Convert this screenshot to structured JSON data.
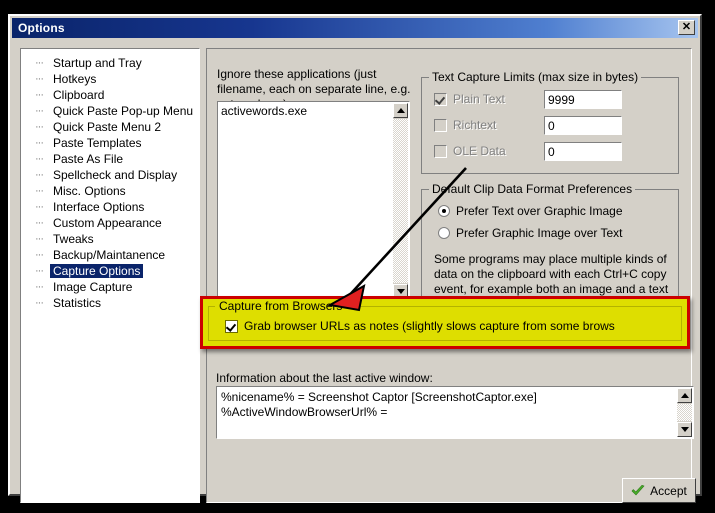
{
  "window": {
    "title": "Options",
    "close_label": "✕"
  },
  "sidebar": {
    "items": [
      {
        "label": "Startup and Tray",
        "selected": false
      },
      {
        "label": "Hotkeys",
        "selected": false
      },
      {
        "label": "Clipboard",
        "selected": false
      },
      {
        "label": "Quick Paste Pop-up Menu",
        "selected": false
      },
      {
        "label": "Quick Paste Menu 2",
        "selected": false
      },
      {
        "label": "Paste Templates",
        "selected": false
      },
      {
        "label": "Paste As File",
        "selected": false
      },
      {
        "label": "Spellcheck and Display",
        "selected": false
      },
      {
        "label": "Misc. Options",
        "selected": false
      },
      {
        "label": "Interface Options",
        "selected": false
      },
      {
        "label": "Custom Appearance",
        "selected": false
      },
      {
        "label": "Tweaks",
        "selected": false
      },
      {
        "label": "Backup/Maintanence",
        "selected": false
      },
      {
        "label": "Capture Options",
        "selected": true
      },
      {
        "label": "Image Capture",
        "selected": false
      },
      {
        "label": "Statistics",
        "selected": false
      }
    ]
  },
  "ignore_apps": {
    "label": "Ignore these applications (just filename, each on separate line, e.g. notepad.exe)",
    "value": "activewords.exe"
  },
  "text_capture_limits": {
    "title": "Text Capture Limits (max size in bytes)",
    "rows": [
      {
        "label": "Plain Text",
        "checked": true,
        "value": "9999"
      },
      {
        "label": "Richtext",
        "checked": false,
        "value": "0"
      },
      {
        "label": "OLE Data",
        "checked": false,
        "value": "0"
      }
    ]
  },
  "clip_format": {
    "title": "Default Clip Data Format Preferences",
    "option_text_first": "Prefer Text over Graphic Image",
    "option_image_first": "Prefer Graphic Image over Text",
    "selected": "text_first",
    "description": "Some programs may place multiple kinds of data on the clipboard with each Ctrl+C copy event, for example both an image and a text representation of some data.  Here you can specify which format should be captured by default."
  },
  "capture_browsers": {
    "title": "Capture from Browsers",
    "checkbox_label": "Grab browser URLs as notes (slightly slows capture from some brows",
    "checked": true,
    "highlight_border_color": "#cc0000",
    "highlight_fill_color": "#dede00"
  },
  "last_window_info": {
    "label": "Information about the last active window:",
    "value": "%nicename% = Screenshot Captor [ScreenshotCaptor.exe]\n%ActiveWindowBrowserUrl% ="
  },
  "footer": {
    "accept_label": "Accept"
  }
}
